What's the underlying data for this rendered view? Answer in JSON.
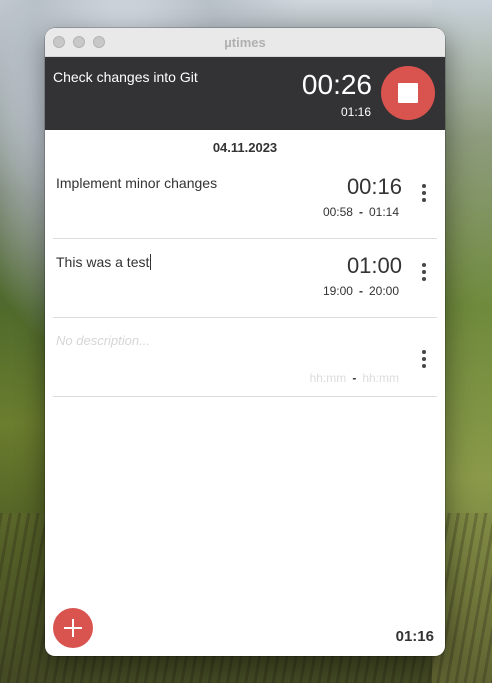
{
  "window": {
    "title": "µtimes"
  },
  "running": {
    "description": "Check changes into Git",
    "elapsed": "00:26",
    "total": "01:16"
  },
  "date": "04.11.2023",
  "entries": [
    {
      "description": "Implement minor changes",
      "duration": "00:16",
      "start": "00:58",
      "end": "01:14"
    },
    {
      "description": "This was a test",
      "duration": "01:00",
      "start": "19:00",
      "end": "20:00"
    },
    {
      "description_placeholder": "No description...",
      "start_placeholder": "hh:mm",
      "end_placeholder": "hh:mm"
    }
  ],
  "footer": {
    "total": "01:16"
  },
  "colors": {
    "accent": "#d9534f",
    "header_bg": "#333335"
  }
}
